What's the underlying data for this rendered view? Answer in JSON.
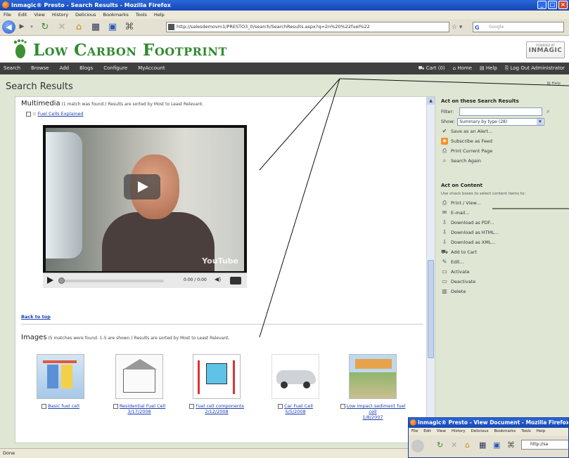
{
  "browser": {
    "title": "Inmagic® Presto - Search Results - Mozilla Firefox",
    "menu": [
      "File",
      "Edit",
      "View",
      "History",
      "Delicious",
      "Bookmarks",
      "Tools",
      "Help"
    ],
    "url": "http://salesdemovm1/PRESTO3_0/search/SearchResults.aspx?q=2n%20%22fuel%22",
    "search_placeholder": "Google",
    "status": "Done"
  },
  "site": {
    "logo": "Low Carbon Footprint",
    "powered_by": "POWERED BY",
    "vendor": "INMAGIC",
    "nav_left": [
      "Search",
      "Browse",
      "Add",
      "Blogs",
      "Configure",
      "MyAccount"
    ],
    "nav_right": [
      "Cart (0)",
      "Home",
      "Help",
      "Log Out Administrator"
    ]
  },
  "page": {
    "title": "Search Results",
    "help": "Help"
  },
  "multimedia": {
    "heading": "Multimedia",
    "note": "(1 match was found.) Results are sorted by Most to Least Relevant.",
    "item_label": "Fuel Cells Explained",
    "video_time": "0:00 / 0:00",
    "video_brand": "YouTube",
    "back_to_top": "Back to top"
  },
  "images": {
    "heading": "Images",
    "note": "(5 matches were found. 1-5 are shown.) Results are sorted by Most to Least Relevant.",
    "items": [
      {
        "caption": "Basic fuel cell",
        "date": ""
      },
      {
        "caption": "Residential Fuel Cell",
        "date": "3/17/2008"
      },
      {
        "caption": "Fuel cell components",
        "date": "2/12/2008"
      },
      {
        "caption": "Car Fuel Cell",
        "date": "5/5/2008"
      },
      {
        "caption": "Low impact sediment fuel cell",
        "date": "1/8/2007"
      }
    ]
  },
  "panel": {
    "search_heading": "Act on these Search Results",
    "filter_label": "Filter:",
    "show_label": "Show:",
    "show_value": "Summary by type (28)",
    "search_actions": [
      "Save as an Alert...",
      "Subscribe as Feed",
      "Print Current Page",
      "Search Again"
    ],
    "content_heading": "Act on Content",
    "content_note": "Use check boxes to select content items to:",
    "content_actions": [
      "Print / View...",
      "E-mail...",
      "Download as PDF...",
      "Download as HTML...",
      "Download as XML...",
      "Add to Cart",
      "Edit...",
      "Activate",
      "Deactivate",
      "Delete"
    ]
  },
  "second_window": {
    "title": "Inmagic® Presto - View Document - Mozilla Firefox",
    "menu": [
      "File",
      "Edit",
      "View",
      "History",
      "Delicious",
      "Bookmarks",
      "Tools",
      "Help"
    ],
    "url": "http://sa"
  },
  "icons": {
    "brand_green": "#2f8a2f",
    "nav_dark": "#3f3f3f",
    "page_bg": "#dfe6d4",
    "link_blue": "#1c3fae"
  }
}
